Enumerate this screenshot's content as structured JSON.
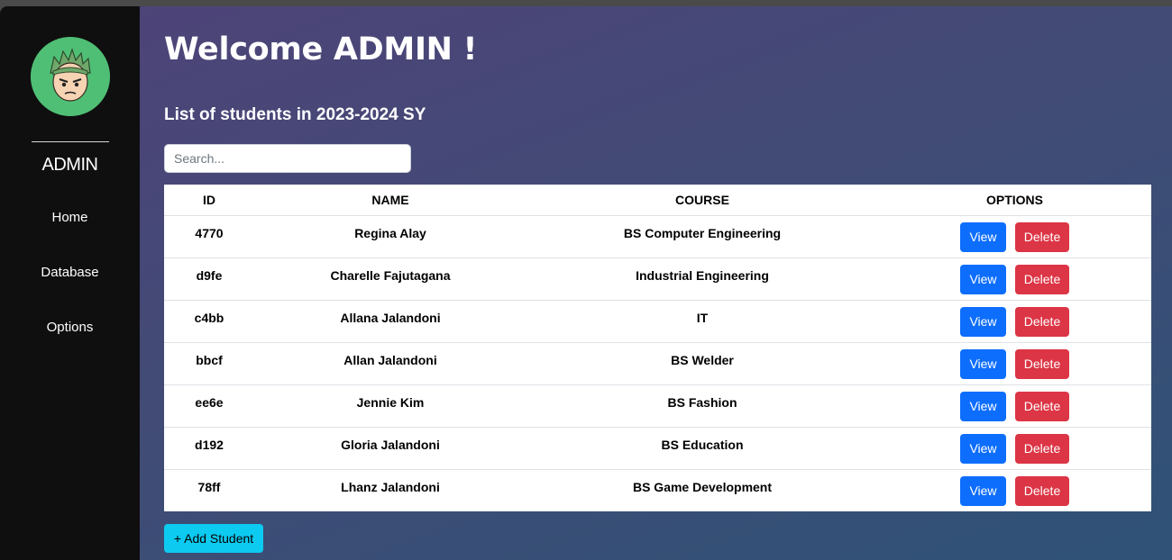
{
  "sidebar": {
    "username": "ADMIN",
    "nav": [
      {
        "label": "Home"
      },
      {
        "label": "Database"
      },
      {
        "label": "Options"
      }
    ]
  },
  "header": {
    "welcome": "Welcome ADMIN !",
    "subtitle": "List of students in 2023-2024 SY"
  },
  "search": {
    "placeholder": "Search...",
    "value": ""
  },
  "table": {
    "columns": [
      "ID",
      "NAME",
      "COURSE",
      "OPTIONS"
    ],
    "rows": [
      {
        "id": "4770",
        "name": "Regina Alay",
        "course": "BS Computer Engineering"
      },
      {
        "id": "d9fe",
        "name": "Charelle Fajutagana",
        "course": "Industrial Engineering"
      },
      {
        "id": "c4bb",
        "name": "Allana Jalandoni",
        "course": "IT"
      },
      {
        "id": "bbcf",
        "name": "Allan Jalandoni",
        "course": "BS Welder"
      },
      {
        "id": "ee6e",
        "name": "Jennie Kim",
        "course": "BS Fashion"
      },
      {
        "id": "d192",
        "name": "Gloria Jalandoni",
        "course": "BS Education"
      },
      {
        "id": "78ff",
        "name": "Lhanz Jalandoni",
        "course": "BS Game Development"
      }
    ],
    "view_label": "View",
    "delete_label": "Delete"
  },
  "actions": {
    "add_student_label": "+ Add Student"
  },
  "colors": {
    "sidebar_bg": "#0f0f0f",
    "view_button": "#0d6efd",
    "delete_button": "#dc3545",
    "add_button": "#0dcaf0",
    "avatar_bg": "#4fbf75"
  },
  "icons": {
    "avatar": "anime-character-avatar-icon"
  }
}
